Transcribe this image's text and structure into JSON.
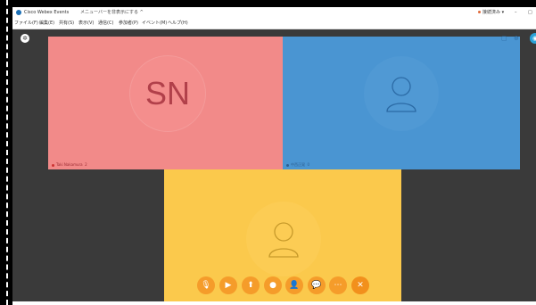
{
  "window": {
    "title": "Cisco Webex Events",
    "menu_hint": "メニューバーを非表示にする ^",
    "connection_status": "接続済み ▾",
    "minimize": "–",
    "maximize": "□"
  },
  "menubar": {
    "items": [
      "ファイル(F)",
      "編集(E)",
      "共有(S)",
      "表示(V)",
      "通信(C)",
      "参加者(P)",
      "イベント(M)",
      "ヘルプ(H)"
    ]
  },
  "stage": {
    "corner_icon": "gear-icon",
    "right_icons": [
      "▢",
      "⊕"
    ]
  },
  "tiles": [
    {
      "initials": "SN",
      "name": "Taki Nakamura",
      "suffix": "2",
      "color": "#f28a89"
    },
    {
      "name": "中西正晃",
      "suffix": "0",
      "color": "#4a95d2"
    },
    {
      "name": "",
      "color": "#fbc94c"
    }
  ],
  "toolbar": {
    "buttons": [
      {
        "icon": "mute-icon",
        "glyph": "🎙"
      },
      {
        "icon": "video-icon",
        "glyph": "▶"
      },
      {
        "icon": "share-icon",
        "glyph": "⬆"
      },
      {
        "icon": "record-icon",
        "glyph": "●"
      },
      {
        "icon": "participants-icon",
        "glyph": "👤"
      },
      {
        "icon": "chat-icon",
        "glyph": "💬"
      },
      {
        "icon": "more-icon",
        "glyph": "⋯"
      },
      {
        "icon": "leave-icon",
        "glyph": "✕"
      }
    ]
  },
  "colors": {
    "sn_tile": "#f28a89",
    "blue_tile": "#4a95d2",
    "yellow_tile": "#fbc94c",
    "toolbar_button": "#f59c2a",
    "stage_bg": "#3a3a3a"
  }
}
